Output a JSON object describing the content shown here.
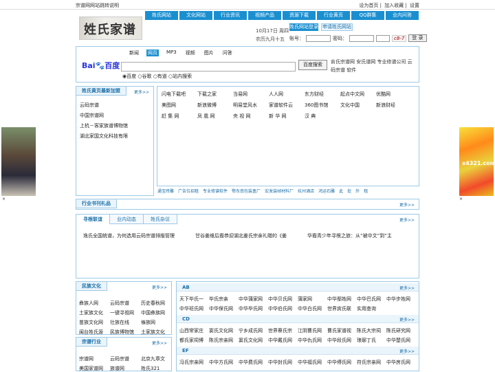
{
  "topbar": {
    "left": "宗谱网网站跳转说明",
    "home": "设为首页",
    "fav": "加入收藏",
    "settings": "设置"
  },
  "logo": {
    "text": "姓氏家谱"
  },
  "nav": [
    "姓氏网站",
    "文化网站",
    "行业资讯",
    "视频产品",
    "资源下载",
    "行业黄页",
    "QQ群集",
    "业内问答"
  ],
  "date": {
    "line1": "10月17日 周四",
    "line2": "农历九月十五"
  },
  "reg": {
    "login_label": "姓氏网站登录",
    "apply_label": "申请姓氏网站",
    "account_label": "账号：",
    "password_label": "密码：",
    "captcha": "c8-7",
    "submit": "登 录"
  },
  "search": {
    "logo_a": "Bai",
    "logo_b": "百度",
    "tabs": [
      "新闻",
      "网页",
      "MP3",
      "视频",
      "图片",
      "问答"
    ],
    "button": "百度搜索",
    "radios": [
      "百度",
      "谷歌",
      "有道",
      "站内搜索"
    ],
    "links": "俞氏宗谱网 安氏谱网 专业修谱公司 云码宗谱 软件"
  },
  "newsites": {
    "title": "姓氏黄页最新加盟",
    "more": "更多>>",
    "items": [
      "云码宗谱",
      "中国宗谱网",
      "上杭－客家族谱博物馆",
      "湖北家国文化科技有限"
    ]
  },
  "sites": [
    [
      "闪电下载吧",
      "下载之家",
      "当易网",
      "人人网",
      "东方财经",
      "起点中文网",
      "优酷网"
    ],
    [
      "美图网",
      "新浪微博",
      "明易堂风水",
      "家谱软件云",
      "360图书馆",
      "文化中国",
      "新浪财经"
    ],
    [
      "赶 集 网",
      "凤 凰 网",
      "央 视 网",
      "新 华 网",
      "汉 典",
      "",
      ""
    ]
  ],
  "adlinks": [
    "通宝砖雕",
    "广告位招租",
    "专业修谱软件",
    "鄂东南包装盒厂",
    "宏发装帧材料厂",
    "杭州酒店",
    "鸿运石雕",
    "此",
    "处",
    "外",
    "租"
  ],
  "gifts": {
    "title": "行业书刊礼品",
    "more": "更多>>"
  },
  "tabs": {
    "items": [
      "寻根联谊",
      "业内动态",
      "姓氏杂议"
    ],
    "more": "更多>>",
    "news": [
      "逸氏全国统谱，为何选用云码宗谱排版管理",
      "甘谷姜维后裔恭迎湖北姜氏宗亲礼赠的《姜",
      "华裔青少年寻根之旅：从“被中文”到“主"
    ]
  },
  "culture": {
    "title": "民族文化",
    "more": "更多>>",
    "items": [
      "彝族人网",
      "云码宗谱",
      "历史春秋网",
      "土家族文化",
      "一键寻祖网",
      "中国彝族网",
      "苗族文化网",
      "壮族在线",
      "傣族网",
      "闽台姓氏源",
      "民族博物馆",
      "土家族文化"
    ]
  },
  "industry": {
    "title": "宗谱行业",
    "more": "更多>>",
    "items": [
      "宗谱网",
      "云码宗谱",
      "北京九章文",
      "美国家谱网",
      "族谱网",
      "姓氏321"
    ]
  },
  "directory": {
    "ab": {
      "title": "AB",
      "more": "更多>>",
      "items": [
        "天下毕氏一",
        "毕氏宗亲",
        "中华蒲家网",
        "中华贝氏网",
        "蒲家网",
        "中华鄢姓网",
        "中华巴氏网",
        "中华步姓网",
        "中华班氏网",
        "中华保氏网",
        "中华毕氏网",
        "中华伯氏网",
        "中华白氏网",
        "世界宾氏联",
        "实用查询",
        ""
      ]
    },
    "cd": {
      "title": "CD",
      "more": "更多>>",
      "items": [
        "山西常家庄",
        "窦氏文化网",
        "宁乡成氏网",
        "世界蔡氏宗",
        "江阴曹氏网",
        "曹氏家谱视",
        "陈氏大宗祠",
        "陈氏研究网",
        "都氏家祠博",
        "陈氏宗亲网",
        "窦氏文化网",
        "中华戴氏网",
        "中华仇氏网",
        "中华段氏网",
        "琅琊丁氏",
        "中华楚氏网"
      ]
    },
    "ef": {
      "title": "EF",
      "more": "更多>>",
      "items": [
        "冯氏宗亲网",
        "中华方氏网",
        "中华费氏网",
        "中华封氏网",
        "中华福氏网",
        "中华傅氏网",
        "符氏宗亲网",
        "中华房氏网"
      ]
    }
  },
  "ads": {
    "left_close": "×",
    "right_close": "×",
    "right_text": "x4321.com"
  }
}
